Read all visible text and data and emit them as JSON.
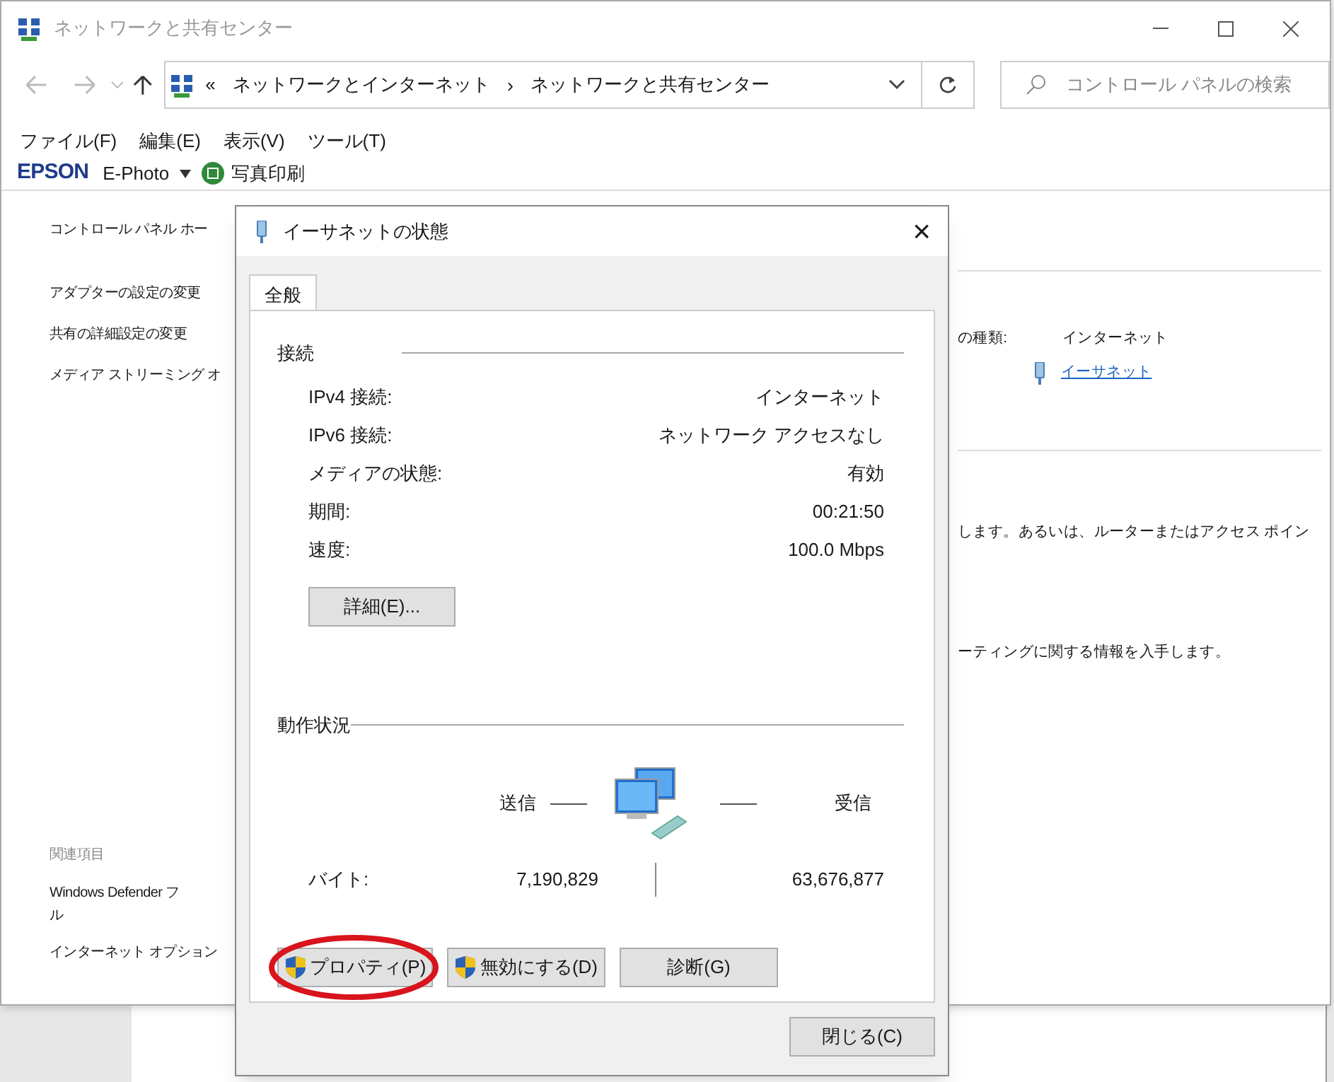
{
  "window": {
    "title": "ネットワークと共有センター"
  },
  "address_bar": {
    "overflow": "«",
    "separator": "›",
    "crumbs": [
      "ネットワークとインターネット",
      "ネットワークと共有センター"
    ]
  },
  "search": {
    "placeholder": "コントロール パネルの検索"
  },
  "menu": [
    "ファイル(F)",
    "編集(E)",
    "表示(V)",
    "ツール(T)"
  ],
  "toolbar": {
    "brand": "EPSON",
    "app": "E-Photo",
    "print": "写真印刷"
  },
  "sidebar": {
    "home": "コントロール パネル ホー",
    "links": [
      "アダプターの設定の変更",
      "共有の詳細設定の変更",
      "メディア ストリーミング オ"
    ],
    "related_heading": "関連項目",
    "related": [
      {
        "lines": [
          "Windows Defender フ",
          "ル"
        ]
      },
      {
        "lines": [
          "インターネット オプション"
        ]
      }
    ]
  },
  "content": {
    "type_label": "の種類:",
    "type_value": "インターネット",
    "connection_link": "イーサネット",
    "text_1": "します。あるいは、ルーターまたはアクセス ポイン",
    "text_2": "ーティングに関する情報を入手します。"
  },
  "dialog": {
    "title": "イーサネットの状態",
    "close": "×",
    "tabs": [
      {
        "label": "全般",
        "selected": true
      }
    ],
    "connection_heading": "接続",
    "rows": [
      {
        "label": "IPv4 接続:",
        "value": "インターネット"
      },
      {
        "label": "IPv6 接続:",
        "value": "ネットワーク アクセスなし"
      },
      {
        "label": "メディアの状態:",
        "value": "有効"
      },
      {
        "label": "期間:",
        "value": "00:21:50"
      },
      {
        "label": "速度:",
        "value": "100.0 Mbps"
      }
    ],
    "details_button": "詳細(E)...",
    "activity_heading": "動作状況",
    "sent_label": "送信",
    "received_label": "受信",
    "bytes_label": "バイト:",
    "bytes_sent": "7,190,829",
    "bytes_received": "63,676,877",
    "buttons": [
      {
        "label": "プロパティ(P)",
        "shield": true,
        "highlighted": true
      },
      {
        "label": "無効にする(D)",
        "shield": true,
        "highlighted": false
      },
      {
        "label": "診断(G)",
        "shield": false,
        "highlighted": false
      }
    ],
    "close_button": "閉じる(C)"
  }
}
